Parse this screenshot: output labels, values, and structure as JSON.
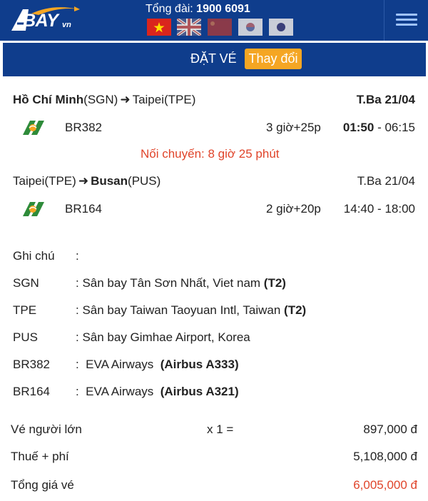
{
  "header": {
    "logo_text": "BAY",
    "logo_suffix": "vn",
    "hotline_label": "Tổng đài:",
    "hotline_number": "1900 6091",
    "languages": [
      "Tiếng Việt",
      "English",
      "中文",
      "한국어",
      "日本語"
    ]
  },
  "booking_bar": {
    "title": "ĐẶT VÉ",
    "change_button": "Thay đổi"
  },
  "legs": [
    {
      "from_city": "Hồ Chí Minh",
      "from_code": "(SGN)",
      "to_city": "Taipei",
      "to_code": "(TPE)",
      "date": "T.Ba 21/04",
      "flight_number": "BR382",
      "duration": "3 giờ+25p",
      "dep_time": "01:50",
      "time_separator": " - ",
      "arr_time": "06:15"
    },
    {
      "from_city": "Taipei",
      "from_code": "(TPE)",
      "to_city": "Busan",
      "to_code": "(PUS)",
      "date": "T.Ba 21/04",
      "flight_number": "BR164",
      "duration": "2 giờ+20p",
      "times": "14:40 - 18:00"
    }
  ],
  "connection": "Nối chuyến: 8 giờ 25 phút",
  "notes": {
    "title": "Ghi chú",
    "colon": ":",
    "items": [
      {
        "code": "SGN",
        "text": ": Sân bay Tân Sơn Nhất, Viet nam ",
        "terminal": "(T2)"
      },
      {
        "code": "TPE",
        "text": ": Sân bay Taiwan Taoyuan Intl, Taiwan ",
        "terminal": "(T2)"
      },
      {
        "code": "PUS",
        "text": ": Sân bay Gimhae Airport, Korea",
        "terminal": ""
      },
      {
        "code": "BR382",
        "text": ":  EVA Airways  ",
        "terminal": "(Airbus A333)"
      },
      {
        "code": "BR164",
        "text": ":  EVA Airways  ",
        "terminal": "(Airbus A321)"
      }
    ]
  },
  "pricing": {
    "adult_label": "Vé người lớn",
    "adult_qty": "x 1 =",
    "adult_price": "897,000 đ",
    "tax_label": "Thuế + phí",
    "tax_price": "5,108,000 đ",
    "total_label": "Tổng giá vé",
    "total_price": "6,005,000 đ"
  },
  "colors": {
    "header_bg": "#0f3d8c",
    "accent_orange": "#f5a623",
    "total_red": "#e0442a",
    "eva_green": "#2e8b3a"
  }
}
